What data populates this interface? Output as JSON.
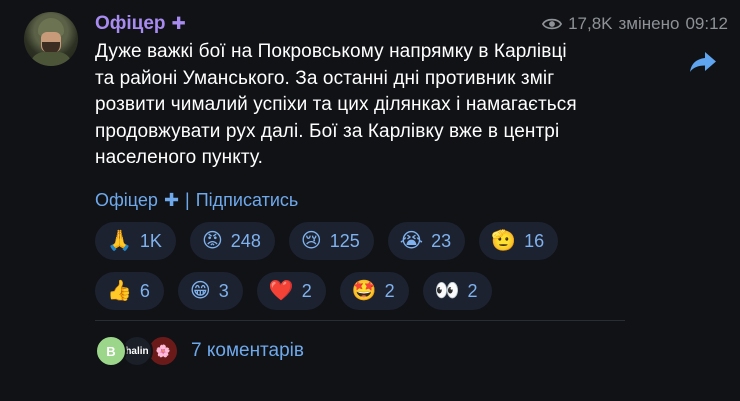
{
  "post": {
    "author": "Офіцер",
    "author_badge": "✚",
    "views": "17,8K",
    "edited_label": "змінено",
    "time": "09:12",
    "text": "Дуже важкі бої на Покровському напрямку в Карлівці\nта районі Уманського. За останні дні противник зміг\nрозвити чималий успіхи та цих ділянках і намагається\nпродовжувати рух далі. Бої за Карлівку вже в центрі\nнаселеного пункту."
  },
  "links": {
    "channel": "Офіцер",
    "channel_badge": "✚",
    "separator": "|",
    "subscribe": "Підписатись"
  },
  "reactions": {
    "row1": [
      {
        "emoji": "🙏",
        "count": "1K"
      },
      {
        "emoji": "😡",
        "count": "248"
      },
      {
        "emoji": "😢",
        "count": "125"
      },
      {
        "emoji": "😭",
        "count": "23"
      },
      {
        "emoji": "🫡",
        "count": "16"
      }
    ],
    "row2": [
      {
        "emoji": "👍",
        "count": "6"
      },
      {
        "emoji": "😁",
        "count": "3"
      },
      {
        "emoji": "❤️",
        "count": "2"
      },
      {
        "emoji": "🤩",
        "count": "2"
      },
      {
        "emoji": "👀",
        "count": "2"
      }
    ]
  },
  "comments": {
    "avatars": [
      "B",
      "halin",
      "🌸"
    ],
    "label": "7 коментарів"
  },
  "colors": {
    "background": "#101216",
    "author": "#a78bf0",
    "link": "#6fa9ec",
    "reaction_bg": "#1d2230",
    "meta": "#8e9196"
  },
  "icons": {
    "views": "eye-icon",
    "share": "share-arrow-icon"
  }
}
